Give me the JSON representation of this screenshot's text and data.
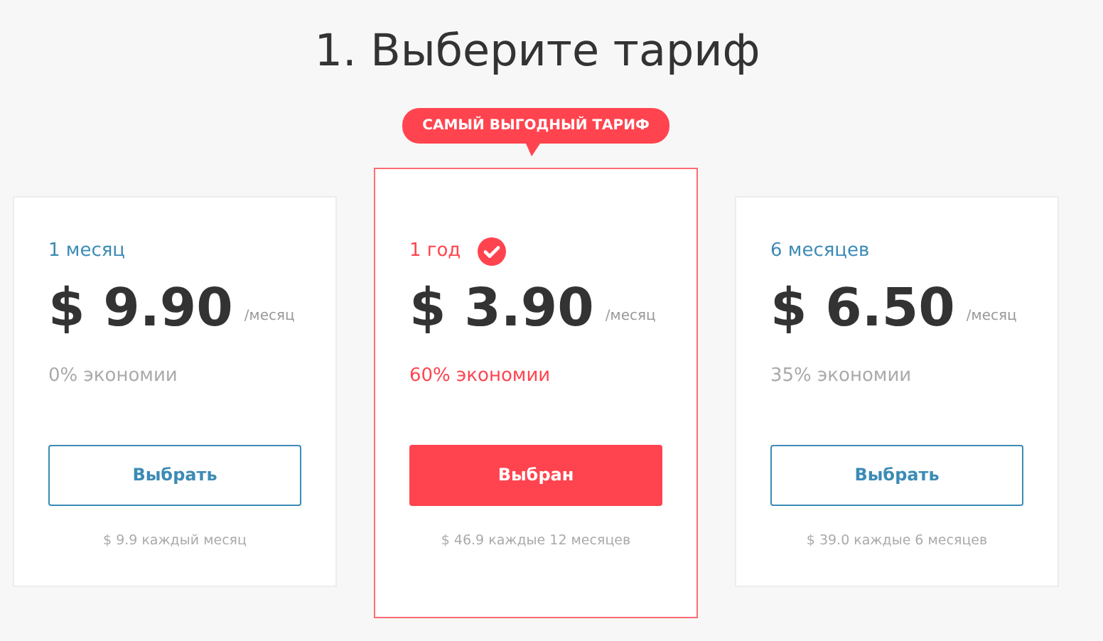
{
  "title": "1. Выберите тариф",
  "plans": [
    {
      "period": "1 месяц",
      "price": "$ 9.90",
      "per": "/месяц",
      "savings": "0% экономии",
      "button": "Выбрать",
      "footnote": "$ 9.9 каждый месяц",
      "selected": false
    },
    {
      "badge": "САМЫЙ ВЫГОДНЫЙ ТАРИФ",
      "period": "1 год",
      "price": "$ 3.90",
      "per": "/месяц",
      "savings": "60% экономии",
      "button": "Выбран",
      "footnote": "$ 46.9 каждые 12 месяцев",
      "selected": true
    },
    {
      "period": "6 месяцев",
      "price": "$ 6.50",
      "per": "/месяц",
      "savings": "35% экономии",
      "button": "Выбрать",
      "footnote": "$ 39.0 каждые 6 месяцев",
      "selected": false
    }
  ]
}
